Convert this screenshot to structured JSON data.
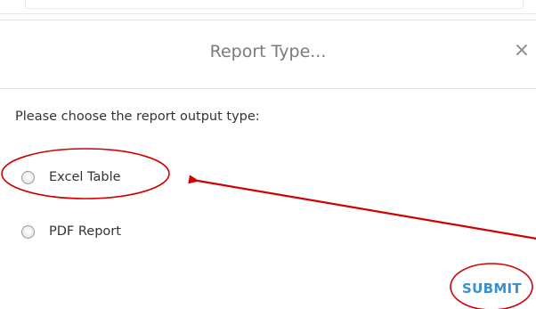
{
  "dialog": {
    "title": "Report Type...",
    "close_glyph": "×",
    "prompt": "Please choose the report output type:",
    "options": [
      {
        "label": "Excel Table",
        "selected": false
      },
      {
        "label": "PDF Report",
        "selected": false
      }
    ],
    "submit_label": "SUBMIT"
  },
  "colors": {
    "title": "#7a7a7a",
    "submit": "#3b8fd0",
    "annotation": "#d10000"
  }
}
